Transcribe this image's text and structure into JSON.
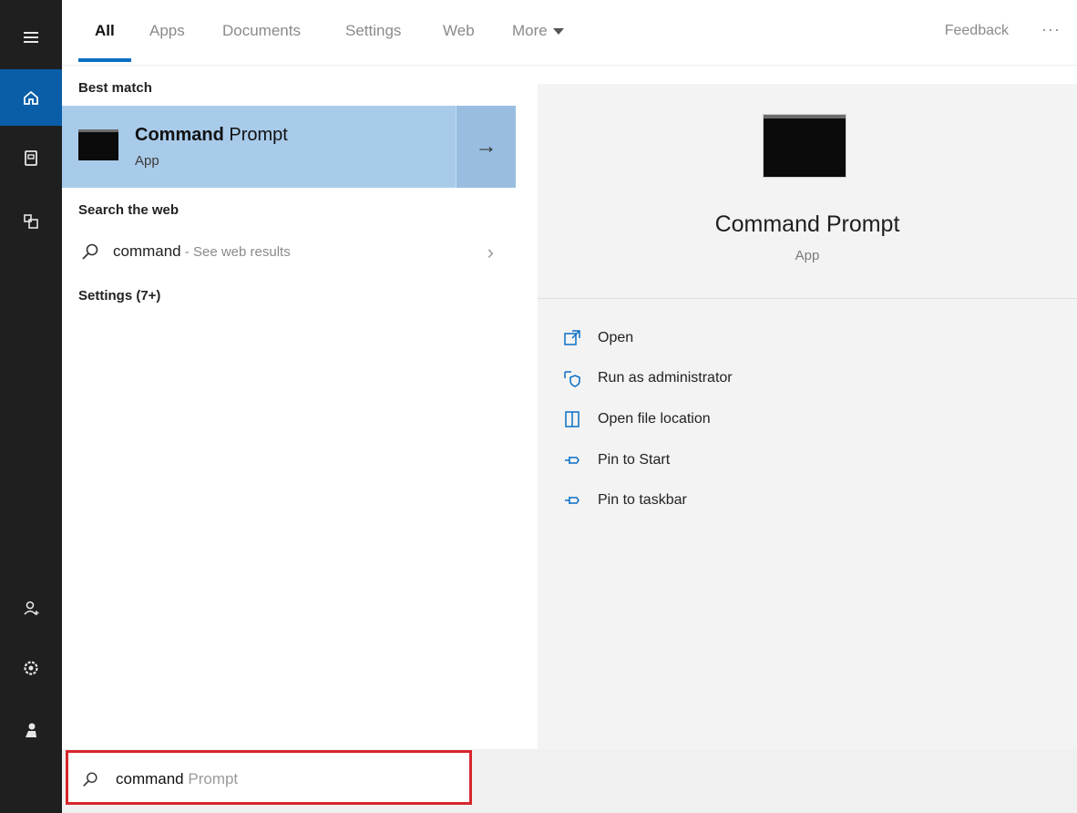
{
  "tabs": {
    "all": "All",
    "apps": "Apps",
    "documents": "Documents",
    "settings": "Settings",
    "web": "Web",
    "more": "More"
  },
  "feedback": "Feedback",
  "overflow": "···",
  "results": {
    "best_match_heading": "Best match",
    "best_match": {
      "title_bold": "Command",
      "title_rest": " Prompt",
      "subtitle": "App",
      "arrow": "→"
    },
    "web_heading": "Search the web",
    "web_item": {
      "term": "command",
      "hint": " - See web results",
      "chevron": "›"
    },
    "settings_heading": "Settings (7+)"
  },
  "detail": {
    "title": "Command Prompt",
    "subtitle": "App",
    "actions": [
      {
        "label": "Open",
        "icon": "open-icon"
      },
      {
        "label": "Run as administrator",
        "icon": "shield-admin-icon"
      },
      {
        "label": "Open file location",
        "icon": "file-location-icon"
      },
      {
        "label": "Pin to Start",
        "icon": "pin-icon"
      },
      {
        "label": "Pin to taskbar",
        "icon": "pin-icon"
      }
    ]
  },
  "search": {
    "typed": "command",
    "suggestion": " Prompt"
  },
  "rail_icons": [
    "hamburger-icon",
    "home-icon",
    "documents-icon",
    "apps-icon",
    "account-icon",
    "settings-icon",
    "user-icon"
  ],
  "colors": {
    "rail": "#1f1f1f",
    "accent": "#0a5ea8",
    "best_match_bg": "#a9cbea",
    "highlight_border": "#d6262c"
  }
}
